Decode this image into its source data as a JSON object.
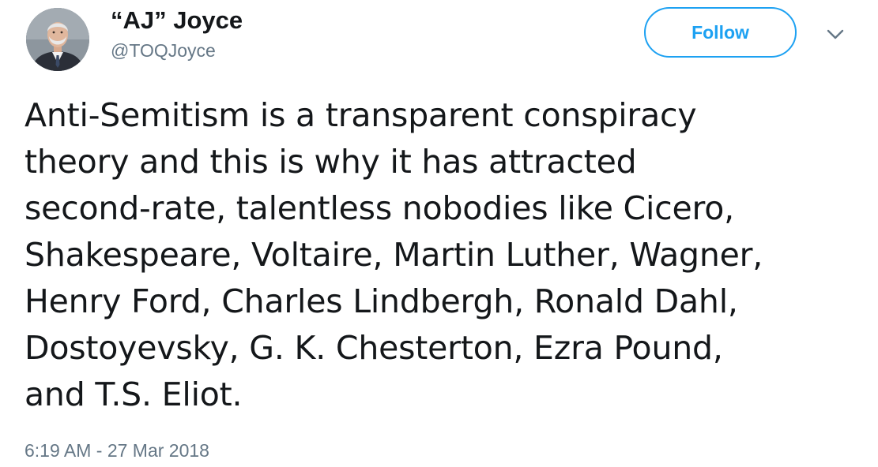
{
  "author": {
    "display_name": "“AJ” Joyce",
    "handle": "@TOQJoyce",
    "avatar_icon": "profile-photo"
  },
  "actions": {
    "follow_label": "Follow",
    "more_icon": "chevron-down-icon"
  },
  "tweet": {
    "text": "Anti-Semitism is a transparent conspiracy\ntheory and this is why it has attracted\nsecond-rate, talentless nobodies like Cicero,\nShakespeare, Voltaire, Martin Luther, Wagner,\nHenry Ford, Charles Lindbergh, Ronald Dahl,\nDostoyevsky, G. K. Chesterton, Ezra Pound,\nand T.S. Eliot.",
    "timestamp": "6:19 AM - 27 Mar 2018"
  },
  "colors": {
    "accent": "#1da1f2",
    "text": "#14171a",
    "secondary_text": "#657786"
  }
}
